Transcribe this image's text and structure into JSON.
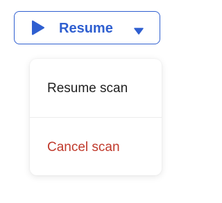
{
  "split_button": {
    "label": "Resume",
    "icon": "play-icon",
    "dropdown_icon": "chevron-down-icon",
    "accent_color": "#2f5fd0"
  },
  "menu": {
    "items": [
      {
        "label": "Resume scan",
        "color": "#1f1f1f"
      },
      {
        "label": "Cancel scan",
        "color": "#c0392b"
      }
    ]
  }
}
